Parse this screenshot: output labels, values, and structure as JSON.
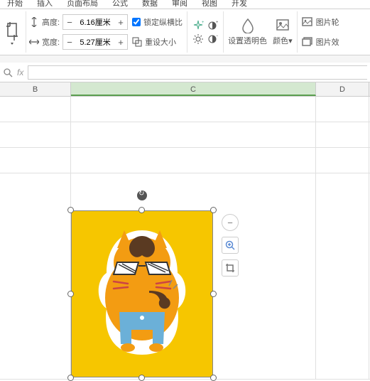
{
  "tabs": [
    "开始",
    "插入",
    "页面布局",
    "公式",
    "数据",
    "审阅",
    "视图",
    "开发"
  ],
  "ribbon": {
    "height_label": "高度:",
    "width_label": "宽度:",
    "height_value": "6.16厘米",
    "width_value": "5.27厘米",
    "lock_ratio": "锁定纵横比",
    "reset_size": "重设大小",
    "set_transparent": "设置透明色",
    "color": "颜色",
    "pic_border": "图片轮",
    "pic_effect": "图片效"
  },
  "columns": {
    "b": "B",
    "c": "C",
    "d": "D"
  },
  "fx": "fx",
  "lock_checked": true
}
